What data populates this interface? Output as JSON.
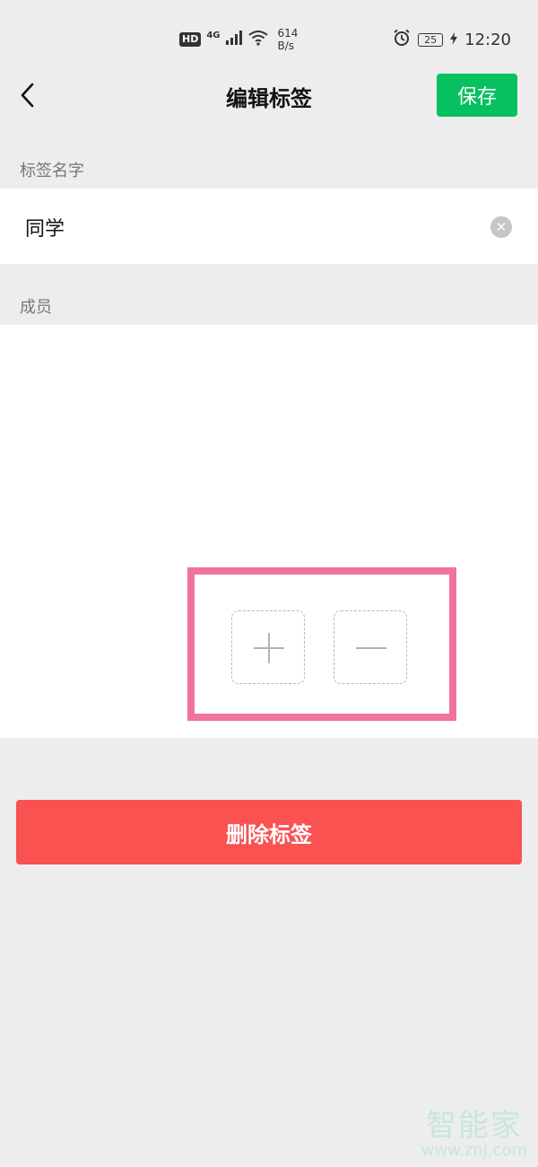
{
  "status_bar": {
    "hd": "HD",
    "network": "4G",
    "speed_value": "614",
    "speed_unit": "B/s",
    "battery": "25",
    "time": "12:20",
    "icons": [
      "signal-icon",
      "wifi-icon",
      "alarm-icon",
      "battery-icon",
      "charging-icon"
    ]
  },
  "nav": {
    "back_icon": "chevron-left-icon",
    "title": "编辑标签",
    "save_label": "保存"
  },
  "tag_name_section": {
    "label": "标签名字",
    "value": "同学",
    "clear_icon": "clear-icon"
  },
  "members_section": {
    "label": "成员",
    "add_icon": "plus-icon",
    "remove_icon": "minus-icon"
  },
  "delete_button": {
    "label": "删除标签"
  },
  "watermark": {
    "text": "智能家",
    "url": "www.znj.com"
  },
  "colors": {
    "background": "#ededed",
    "save_green": "#07c160",
    "delete_red": "#fa5151",
    "highlight_pink": "#f07399"
  }
}
